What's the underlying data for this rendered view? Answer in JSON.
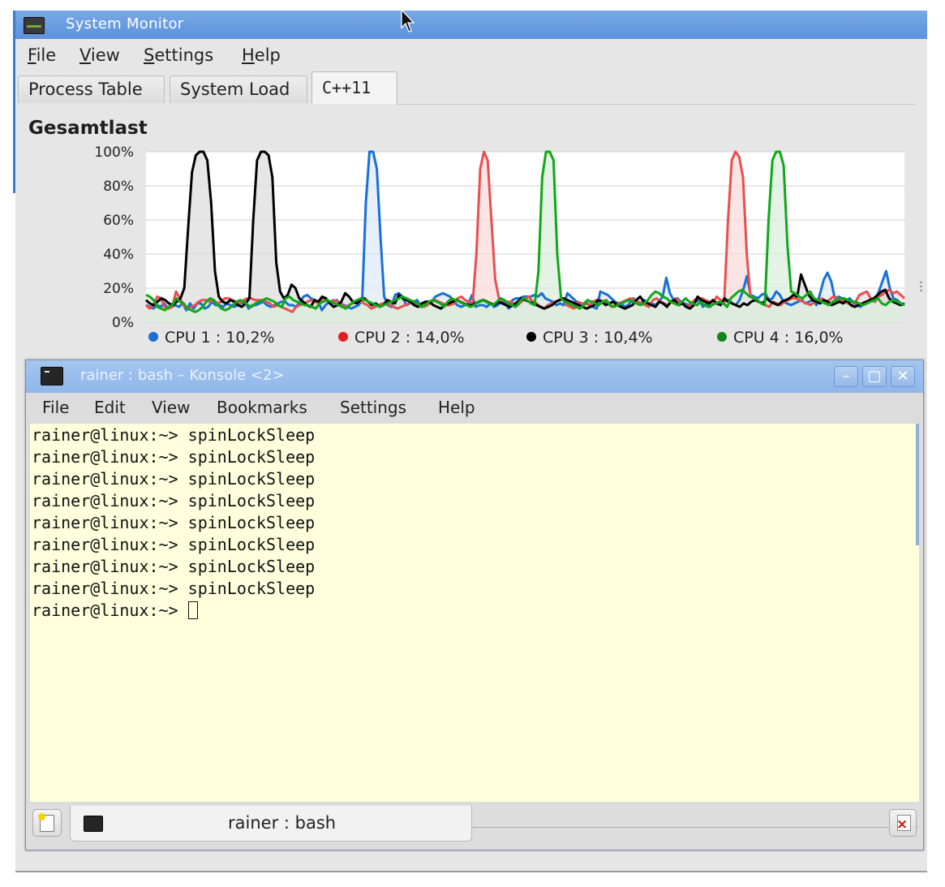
{
  "system_monitor": {
    "title": "System Monitor",
    "menu": [
      "File",
      "View",
      "Settings",
      "Help"
    ],
    "menu_mnemonic_rest": [
      "ile",
      "iew",
      "ettings",
      "elp"
    ],
    "menu_mnemonic_first": [
      "F",
      "V",
      "S",
      "H"
    ],
    "tabs": [
      "Process Table",
      "System Load",
      "C++11"
    ],
    "active_tab": "C++11"
  },
  "chart_data": {
    "type": "area",
    "title": "Gesamtlast",
    "ylim": [
      0,
      100
    ],
    "yticks": [
      "100%",
      "80%",
      "60%",
      "40%",
      "20%",
      "0%"
    ],
    "grid": true,
    "legend_position": "bottom",
    "series": [
      {
        "name": "CPU 1 : 10,2%",
        "color": "#1a6fd8",
        "fill": "#dfe9f7",
        "values": [
          10,
          9,
          8,
          10,
          9,
          11,
          8,
          9,
          10,
          9,
          11,
          7,
          11,
          8,
          11,
          11,
          8,
          9,
          12,
          10,
          10,
          9,
          11,
          10,
          9,
          10,
          11,
          12,
          8,
          10,
          10,
          11,
          12,
          10,
          9,
          10,
          11,
          12,
          12,
          10,
          10,
          9,
          12,
          15,
          16,
          14,
          13,
          12,
          7,
          10,
          12,
          12,
          13,
          11,
          10,
          9,
          8,
          9,
          10,
          13,
          70,
          100,
          100,
          90,
          50,
          15,
          10,
          9,
          16,
          17,
          15,
          10,
          11,
          12,
          13,
          9,
          10,
          11,
          12,
          15,
          16,
          17,
          16,
          15,
          12,
          10,
          9,
          10,
          11,
          16,
          9,
          10,
          10,
          9,
          11,
          9,
          10,
          12,
          11,
          8,
          13,
          14,
          14,
          15,
          15,
          15,
          16,
          15,
          17,
          14,
          13,
          12,
          10,
          11,
          10,
          17,
          15,
          13,
          11,
          9,
          12,
          10,
          9,
          8,
          18,
          17,
          16,
          14,
          12,
          11,
          10,
          9,
          11,
          14,
          12,
          11,
          13,
          11,
          11,
          10,
          12,
          15,
          26,
          17,
          13,
          14,
          12,
          11,
          10,
          11,
          12,
          13,
          9,
          11,
          9,
          12,
          11,
          11,
          12,
          13,
          11,
          10,
          13,
          19,
          27,
          16,
          15,
          14,
          16,
          17,
          13,
          14,
          18,
          16,
          12,
          11,
          10,
          11,
          12,
          13,
          11,
          12,
          13,
          10,
          17,
          25,
          29,
          24,
          14,
          15,
          14,
          12,
          14,
          12,
          10,
          9,
          11,
          12,
          13,
          12,
          18,
          24,
          30,
          20,
          14,
          13,
          11,
          10
        ]
      },
      {
        "name": "CPU 2 : 14,0%",
        "color": "#e85050",
        "fill": "#fadbdb",
        "values": [
          10,
          8,
          10,
          15,
          14,
          9,
          8,
          9,
          18,
          14,
          10,
          8,
          9,
          10,
          12,
          13,
          13,
          12,
          13,
          11,
          12,
          14,
          14,
          13,
          12,
          11,
          13,
          14,
          14,
          13,
          13,
          13,
          12,
          11,
          9,
          10,
          9,
          8,
          7,
          6,
          9,
          10,
          11,
          12,
          13,
          12,
          11,
          14,
          13,
          12,
          13,
          12,
          10,
          9,
          10,
          11,
          12,
          13,
          11,
          10,
          8,
          9,
          10,
          11,
          11,
          10,
          9,
          8,
          9,
          10,
          11,
          12,
          11,
          10,
          9,
          10,
          12,
          13,
          12,
          11,
          10,
          10,
          11,
          14,
          15,
          13,
          12,
          11,
          40,
          90,
          100,
          95,
          60,
          25,
          14,
          13,
          12,
          12,
          11,
          10,
          12,
          14,
          15,
          12,
          11,
          9,
          8,
          10,
          11,
          12,
          13,
          14,
          10,
          9,
          8,
          12,
          11,
          11,
          10,
          12,
          13,
          13,
          12,
          11,
          9,
          10,
          11,
          12,
          13,
          14,
          13,
          12,
          11,
          10,
          9,
          13,
          14,
          12,
          11,
          10,
          12,
          14,
          12,
          11,
          9,
          10,
          13,
          14,
          14,
          13,
          12,
          11,
          15,
          13,
          12,
          60,
          95,
          100,
          97,
          85,
          40,
          15,
          14,
          12,
          11,
          10,
          9,
          12,
          11,
          10,
          12,
          13,
          14,
          14,
          13,
          12,
          11,
          10,
          12,
          13,
          14,
          12,
          13,
          15,
          14,
          13,
          12,
          11,
          10,
          12,
          16,
          17,
          18,
          14,
          12,
          15,
          16,
          18,
          19,
          17,
          18,
          16,
          14
        ]
      },
      {
        "name": "CPU 3 : 10,4%",
        "color": "#000000",
        "fill": "#dddddd",
        "values": [
          13,
          11,
          10,
          12,
          14,
          13,
          11,
          10,
          12,
          14,
          20,
          55,
          88,
          98,
          100,
          100,
          95,
          70,
          30,
          15,
          12,
          11,
          13,
          12,
          10,
          9,
          11,
          14,
          60,
          95,
          100,
          100,
          98,
          85,
          35,
          18,
          14,
          16,
          22,
          20,
          14,
          12,
          10,
          9,
          13,
          12,
          15,
          14,
          11,
          9,
          10,
          12,
          17,
          15,
          12,
          11,
          13,
          14,
          12,
          10,
          11,
          9,
          10,
          13,
          12,
          11,
          16,
          14,
          13,
          12,
          10,
          9,
          11,
          12,
          12,
          10,
          9,
          8,
          10,
          11,
          12,
          13,
          12,
          11,
          10,
          10,
          11,
          12,
          13,
          12,
          11,
          10,
          12,
          11,
          10,
          9,
          10,
          12,
          14,
          13,
          12,
          11,
          10,
          9,
          8,
          9,
          10,
          12,
          13,
          14,
          13,
          12,
          11,
          10,
          9,
          8,
          9,
          10,
          13,
          12,
          10,
          11,
          12,
          10,
          9,
          8,
          9,
          10,
          13,
          15,
          12,
          11,
          10,
          9,
          12,
          11,
          9,
          12,
          13,
          10,
          11,
          9,
          8,
          10,
          15,
          13,
          12,
          11,
          13,
          11,
          10,
          14,
          12,
          11,
          10,
          9,
          11,
          10,
          12,
          13,
          12,
          11,
          14,
          12,
          11,
          10,
          12,
          13,
          14,
          16,
          15,
          28,
          22,
          16,
          13,
          12,
          11,
          13,
          12,
          10,
          11,
          12,
          11,
          13,
          10,
          9,
          10,
          11,
          12,
          13,
          14,
          16,
          18,
          19,
          14,
          12,
          11,
          10,
          11
        ]
      },
      {
        "name": "CPU 4 : 16,0%",
        "color": "#10a818",
        "fill": "#dcefdd",
        "values": [
          16,
          15,
          13,
          9,
          8,
          7,
          9,
          10,
          14,
          12,
          11,
          8,
          7,
          6,
          7,
          9,
          12,
          14,
          13,
          10,
          8,
          7,
          8,
          10,
          12,
          13,
          12,
          10,
          9,
          11,
          12,
          13,
          14,
          13,
          12,
          10,
          9,
          14,
          15,
          13,
          12,
          11,
          10,
          10,
          9,
          8,
          11,
          12,
          13,
          12,
          11,
          10,
          9,
          8,
          10,
          12,
          13,
          14,
          13,
          12,
          11,
          10,
          9,
          10,
          11,
          12,
          13,
          14,
          15,
          14,
          13,
          12,
          11,
          9,
          10,
          12,
          13,
          12,
          11,
          9,
          12,
          14,
          13,
          12,
          11,
          10,
          9,
          10,
          12,
          13,
          12,
          11,
          10,
          12,
          14,
          13,
          11,
          10,
          9,
          12,
          14,
          13,
          11,
          10,
          30,
          85,
          100,
          100,
          95,
          40,
          14,
          12,
          11,
          10,
          9,
          8,
          10,
          13,
          12,
          11,
          10,
          12,
          13,
          10,
          9,
          10,
          11,
          12,
          13,
          12,
          11,
          10,
          11,
          13,
          16,
          18,
          17,
          15,
          14,
          12,
          11,
          10,
          12,
          14,
          12,
          11,
          10,
          12,
          10,
          9,
          10,
          11,
          12,
          11,
          9,
          14,
          16,
          18,
          19,
          17,
          15,
          14,
          13,
          11,
          10,
          60,
          95,
          100,
          100,
          92,
          45,
          18,
          17,
          15,
          14,
          16,
          18,
          14,
          13,
          12,
          11,
          10,
          12,
          13,
          14,
          14,
          13,
          12,
          12,
          11,
          10,
          11,
          12,
          13,
          14,
          11,
          10,
          12,
          13,
          12,
          11,
          10
        ]
      }
    ]
  },
  "konsole": {
    "title": "rainer : bash – Konsole <2>",
    "menu": [
      "File",
      "Edit",
      "View",
      "Bookmarks",
      "Settings",
      "Help"
    ],
    "lines": [
      "rainer@linux:~> spinLockSleep",
      "rainer@linux:~> spinLockSleep",
      "rainer@linux:~> spinLockSleep",
      "rainer@linux:~> spinLockSleep",
      "rainer@linux:~> spinLockSleep",
      "rainer@linux:~> spinLockSleep",
      "rainer@linux:~> spinLockSleep",
      "rainer@linux:~> spinLockSleep"
    ],
    "prompt": "rainer@linux:~> ",
    "tab_label": "rainer : bash",
    "window_buttons": [
      "–",
      "▢",
      "✕"
    ]
  }
}
